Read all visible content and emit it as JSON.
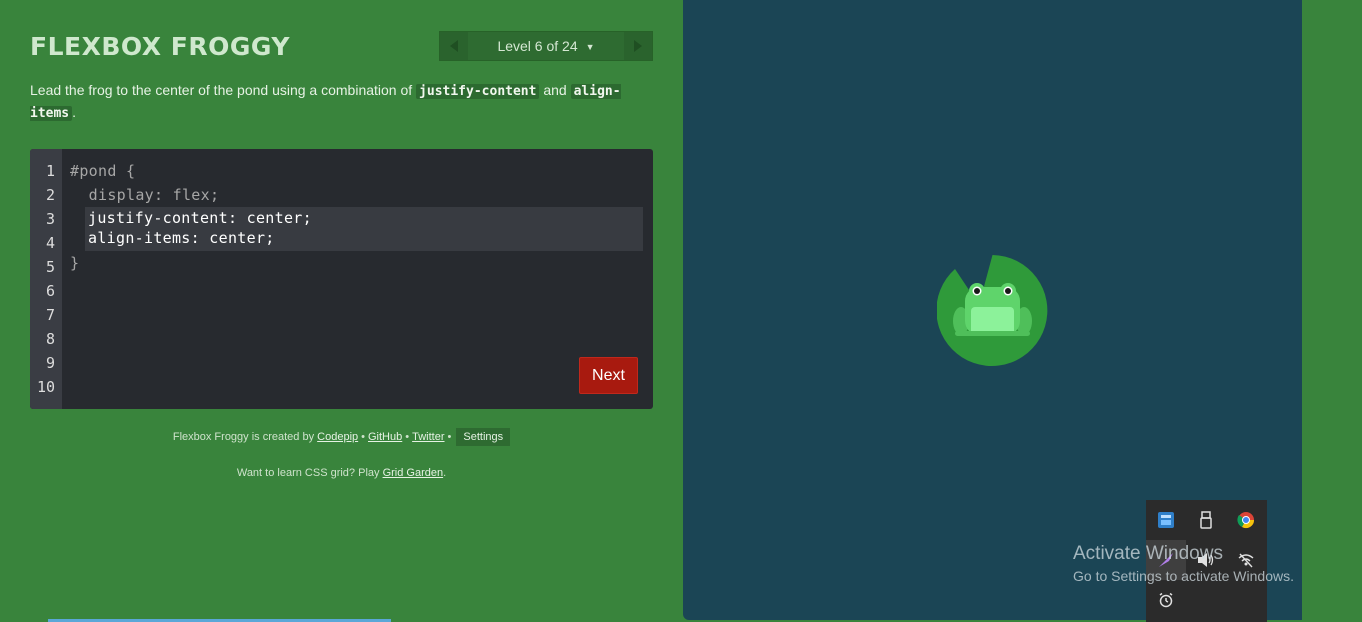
{
  "header": {
    "title": "Flexbox Froggy",
    "level_indicator": "Level 6 of 24"
  },
  "instructions": {
    "before": "Lead the frog to the center of the pond using a combination of ",
    "code1": "justify-content",
    "middle": " and ",
    "code2": "align-items",
    "after": "."
  },
  "editor": {
    "line_numbers": [
      "1",
      "2",
      "3",
      "4",
      "5",
      "6",
      "7",
      "8",
      "9",
      "10"
    ],
    "line1": "#pond {",
    "line2": "  display: flex;",
    "answer_line1": "justify-content: center;",
    "answer_line2": "align-items: center;",
    "line5": "}",
    "next_label": "Next"
  },
  "credits": {
    "prefix": "Flexbox Froggy is created by ",
    "codepip": "Codepip",
    "github": "GitHub",
    "twitter": "Twitter",
    "bullet": "•",
    "settings": "Settings"
  },
  "promo": {
    "text": "Want to learn CSS grid? Play ",
    "link": "Grid Garden",
    "suffix": "."
  },
  "watermark": {
    "line1": "Activate Windows",
    "line2": "Go to Settings to activate Windows."
  },
  "colors": {
    "background": "#39843c",
    "pond": "#1b4555",
    "next_button": "#a81a0f",
    "lilypad": "#2f9a3a",
    "frog": "#5fd46b"
  }
}
